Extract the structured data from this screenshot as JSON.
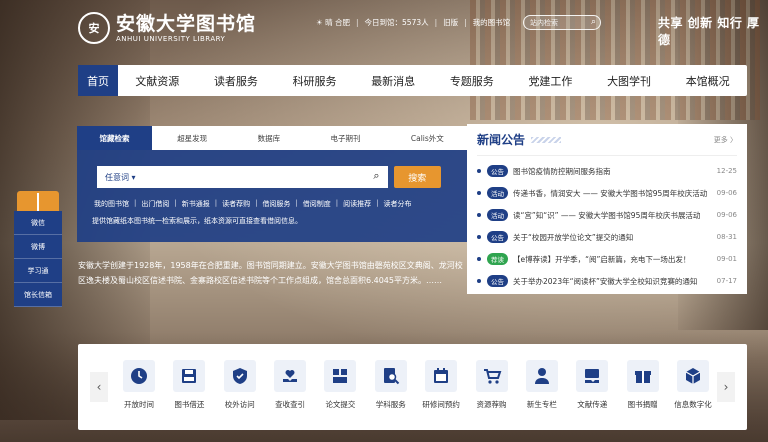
{
  "header": {
    "logo_mark": "安",
    "logo_cn": "安徽大学图书馆",
    "logo_en": "ANHUI UNIVERSITY LIBRARY",
    "weather": "☀ 晴 合肥",
    "visits": "今日到馆：5573人",
    "old_version": "旧版",
    "my_library": "我的图书馆",
    "search_placeholder": "站内检索",
    "motto": "共享 创新 知行 厚德"
  },
  "nav": [
    "首页",
    "文献资源",
    "读者服务",
    "科研服务",
    "最新消息",
    "专题服务",
    "党建工作",
    "大图学刊",
    "本馆概况"
  ],
  "search": {
    "tabs": [
      "馆藏检索",
      "超星发现",
      "数据库",
      "电子期刊",
      "Calis外文"
    ],
    "select_label": "任意词 ▾",
    "query_value": "",
    "button": "搜索",
    "quick_links": [
      "我的图书馆",
      "出门借阅",
      "新书通报",
      "读者荐购",
      "借阅服务",
      "借阅制度",
      "阅读推荐",
      "读者分布"
    ],
    "hint": "提供馆藏纸本图书统一检索和展示，纸本资源可直接查看借阅信息。"
  },
  "side": [
    "微信",
    "微博",
    "学习通",
    "馆长信箱"
  ],
  "intro": "安徽大学创建于1928年，1958年在合肥重建。图书馆同期建立。安徽大学图书馆由磬苑校区文典阁、龙河校区逸夫楼及蜀山校区信述书院、金寨路校区信述书院等个工作点组成，馆舍总面积6.4045平方米。……",
  "news": {
    "title": "新闻公告",
    "more": "更多 〉",
    "items": [
      {
        "tag": "公告",
        "color": "#1f3f86",
        "text": "图书馆疫情防控期间服务指南",
        "date": "12-25"
      },
      {
        "tag": "活动",
        "color": "#1f3f86",
        "text": "传递书香，情润安大 —— 安徽大学图书馆95周年校庆活动",
        "date": "09-06"
      },
      {
        "tag": "活动",
        "color": "#1f3f86",
        "text": "读“宫”知“识” —— 安徽大学图书馆95周年校庆书展活动",
        "date": "09-06"
      },
      {
        "tag": "公告",
        "color": "#1f3f86",
        "text": "关于“校园开放学位论文”提交的通知",
        "date": "08-31"
      },
      {
        "tag": "荐读",
        "color": "#2fa44f",
        "text": "【e博荐读】开学季，“阅”启新篇，充电下一场出发！",
        "date": "09-01"
      },
      {
        "tag": "公告",
        "color": "#1f3f86",
        "text": "关于举办2023年“阅读杯”安徽大学全校知识竞赛的通知",
        "date": "07-17"
      }
    ]
  },
  "services": {
    "prev": "‹",
    "next": "›",
    "items": [
      {
        "label": "开放时间",
        "icon": "clock-icon"
      },
      {
        "label": "图书借还",
        "icon": "book-save-icon"
      },
      {
        "label": "校外访问",
        "icon": "shield-icon"
      },
      {
        "label": "查收查引",
        "icon": "heart-hand-icon"
      },
      {
        "label": "论文提交",
        "icon": "grid-icon"
      },
      {
        "label": "学科服务",
        "icon": "search-doc-icon"
      },
      {
        "label": "研修间预约",
        "icon": "calendar-icon"
      },
      {
        "label": "资源荐购",
        "icon": "cart-icon"
      },
      {
        "label": "新生专栏",
        "icon": "person-icon"
      },
      {
        "label": "文献传递",
        "icon": "handover-icon"
      },
      {
        "label": "图书捐赠",
        "icon": "gift-icon"
      },
      {
        "label": "信息数字化",
        "icon": "cube-icon"
      }
    ]
  }
}
